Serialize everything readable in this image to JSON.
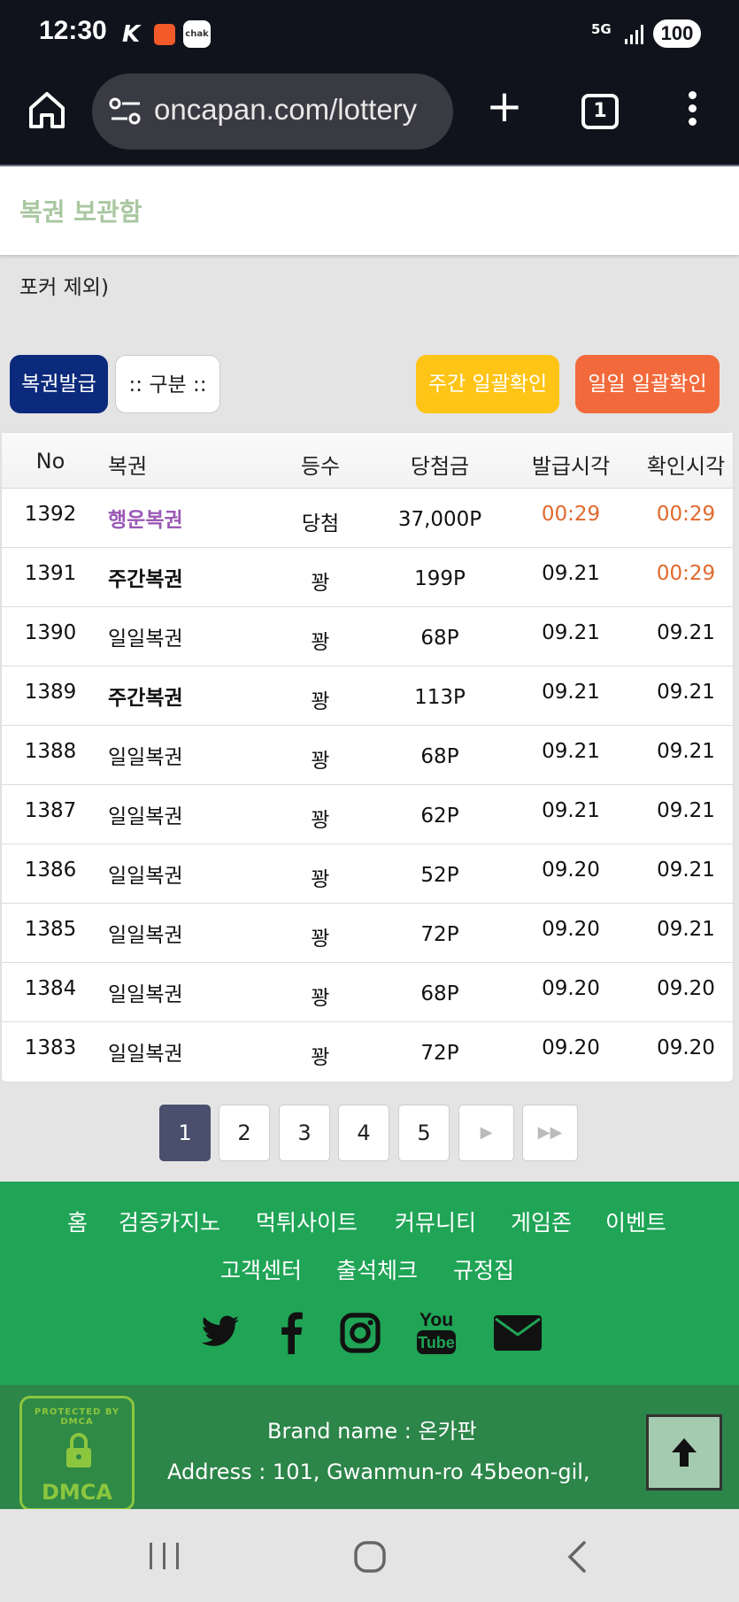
{
  "status_bar": {
    "time": "12:30",
    "network": "5G",
    "battery": "100"
  },
  "browser": {
    "url": "oncapan.com/lottery",
    "tab_count": "1"
  },
  "page": {
    "title": "복권 보관함",
    "notice": "포커 제외)"
  },
  "actions": {
    "issue": "복권발급",
    "category": ":: 구분 ::",
    "weekly_check": "주간 일괄확인",
    "daily_check": "일일 일괄확인"
  },
  "table": {
    "headers": {
      "no": "No",
      "name": "복권",
      "rank": "등수",
      "prize": "당첨금",
      "issued": "발급시각",
      "checked": "확인시각"
    },
    "rows": [
      {
        "no": "1392",
        "name": "행운복권",
        "rank": "당첨",
        "prize": "37,000P",
        "issued": "00:29",
        "checked": "00:29"
      },
      {
        "no": "1391",
        "name": "주간복권",
        "rank": "꽝",
        "prize": "199P",
        "issued": "09.21",
        "checked": "00:29"
      },
      {
        "no": "1390",
        "name": "일일복권",
        "rank": "꽝",
        "prize": "68P",
        "issued": "09.21",
        "checked": "09.21"
      },
      {
        "no": "1389",
        "name": "주간복권",
        "rank": "꽝",
        "prize": "113P",
        "issued": "09.21",
        "checked": "09.21"
      },
      {
        "no": "1388",
        "name": "일일복권",
        "rank": "꽝",
        "prize": "68P",
        "issued": "09.21",
        "checked": "09.21"
      },
      {
        "no": "1387",
        "name": "일일복권",
        "rank": "꽝",
        "prize": "62P",
        "issued": "09.21",
        "checked": "09.21"
      },
      {
        "no": "1386",
        "name": "일일복권",
        "rank": "꽝",
        "prize": "52P",
        "issued": "09.20",
        "checked": "09.21"
      },
      {
        "no": "1385",
        "name": "일일복권",
        "rank": "꽝",
        "prize": "72P",
        "issued": "09.20",
        "checked": "09.21"
      },
      {
        "no": "1384",
        "name": "일일복권",
        "rank": "꽝",
        "prize": "68P",
        "issued": "09.20",
        "checked": "09.20"
      },
      {
        "no": "1383",
        "name": "일일복권",
        "rank": "꽝",
        "prize": "72P",
        "issued": "09.20",
        "checked": "09.20"
      }
    ]
  },
  "pagination": {
    "pages": [
      "1",
      "2",
      "3",
      "4",
      "5"
    ],
    "current": "1"
  },
  "footer": {
    "links": [
      "홈",
      "검증카지노",
      "먹튀사이트",
      "커뮤니티",
      "게임존",
      "이벤트",
      "고객센터",
      "출석체크",
      "규정집"
    ],
    "social": [
      "twitter-icon",
      "facebook-icon",
      "instagram-icon",
      "youtube-icon",
      "email-icon"
    ],
    "dmca_badge": "PROTECTED BY DMCA",
    "brand": "Brand name : 온카판",
    "address": "Address : 101, Gwanmun-ro 45beon-gil,"
  },
  "colors": {
    "header_bg": "#11131c",
    "title": "#a9c7a1",
    "issue_btn": "#0b2a7c",
    "weekly_btn": "#fec416",
    "daily_btn": "#f26a3b",
    "lucky_name": "#9b59b6",
    "time_highlight": "#e06a2e",
    "footer_bg": "#20a456",
    "footer2_bg": "#2c8549"
  }
}
